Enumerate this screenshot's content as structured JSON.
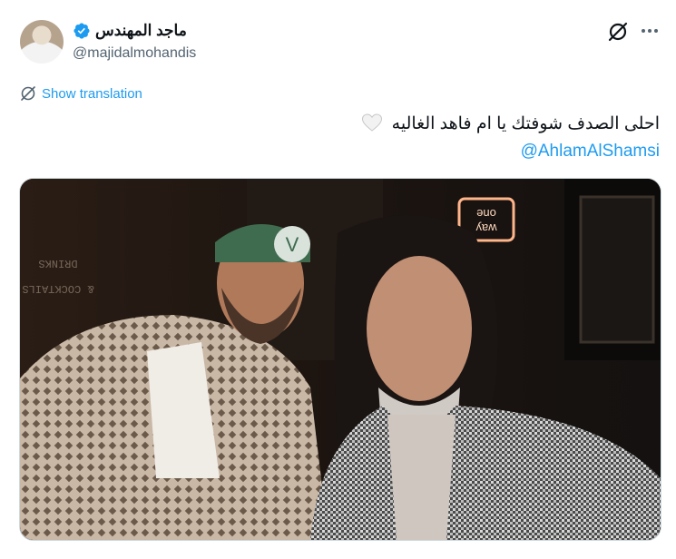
{
  "author": {
    "display_name": "ماجد المهندس",
    "handle": "@majidalmohandis"
  },
  "translation": {
    "label": "Show translation"
  },
  "tweet": {
    "text": "احلى الصدف شوفتك يا ام فاهد الغاليه",
    "mention": "@AhlamAlShamsi"
  },
  "photo": {
    "neon_sign": [
      "one",
      "way"
    ],
    "wall_sign": [
      "DRINKS",
      "& COCKTAILS"
    ]
  },
  "colors": {
    "accent": "#1d9bf0",
    "text": "#0f1419",
    "secondary": "#536471"
  },
  "icons": [
    "avatar",
    "verified-badge-icon",
    "grok-icon",
    "more-icon",
    "globe-icon",
    "white-heart-icon"
  ]
}
